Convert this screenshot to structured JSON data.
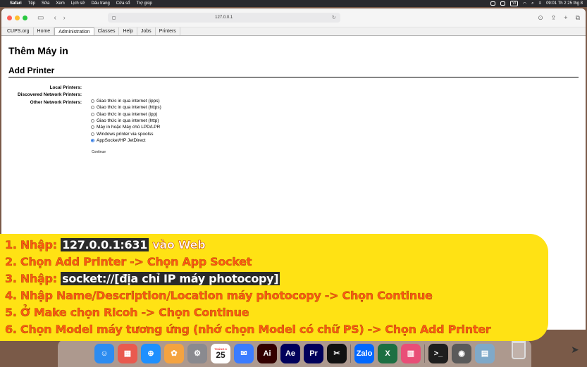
{
  "menubar": {
    "apple": "",
    "items": [
      "Safari",
      "Tệp",
      "Sửa",
      "Xem",
      "Lịch sử",
      "Dấu trang",
      "Cửa sổ",
      "Trợ giúp"
    ],
    "vi_badge": "VI",
    "clock": "09:01 Th 2 25 thg 8"
  },
  "browser": {
    "url": "127.0.0.1",
    "tabs": [
      "CUPS.org",
      "Home",
      "Administration",
      "Classes",
      "Help",
      "Jobs",
      "Printers"
    ],
    "active_tab": "Administration"
  },
  "page": {
    "title_vi": "Thêm Máy in",
    "title_en": "Add Printer",
    "local_printers_label": "Local Printers:",
    "discovered_label": "Discovered Network Printers:",
    "other_label": "Other Network Printers:",
    "options": [
      "Giao thức in qua internet (ipps)",
      "Giao thức in qua internet (https)",
      "Giao thức in qua internet (ipp)",
      "Giao thức in qua internet (http)",
      "Máy in hoặc Máy chủ LPD/LPR",
      "Windows printer via spoolss",
      "AppSocket/HP JetDirect"
    ],
    "selected_option": "AppSocket/HP JetDirect",
    "continue_label": "Continue"
  },
  "instructions": {
    "s1_prefix": "1. Nhập: ",
    "s1_highlight": "127.0.0.1:631",
    "s1_suffix": " vào Web",
    "s2": "2. Chọn Add Printer -> Chọn App Socket",
    "s3_prefix": "3. Nhập: ",
    "s3_highlight": "socket://[địa chỉ IP máy photocopy]",
    "s4": "4. Nhập Name/Description/Location máy photocopy -> Chọn Continue",
    "s5": "5. Ở Make chọn Ricoh -> Chọn Continue",
    "s6": "6. Chọn Model máy tương ứng (nhớ chọn Model có chữ PS) -> Chọn Add Printer"
  },
  "dock": {
    "calendar_month": "THÁNG 8",
    "calendar_day": "25",
    "apps": [
      {
        "name": "finder",
        "label": "☺",
        "color": "#2d8cf0"
      },
      {
        "name": "launchpad",
        "label": "▦",
        "color": "#e95a4f"
      },
      {
        "name": "safari",
        "label": "⊕",
        "color": "#1e90ff"
      },
      {
        "name": "photos",
        "label": "✿",
        "color": "#f4a340"
      },
      {
        "name": "settings",
        "label": "⚙",
        "color": "#8a8a8f"
      },
      {
        "name": "calendar",
        "label": "",
        "color": "#ffffff"
      },
      {
        "name": "messenger",
        "label": "✉",
        "color": "#3b7cff"
      },
      {
        "name": "illustrator",
        "label": "Ai",
        "color": "#330000"
      },
      {
        "name": "after-effects",
        "label": "Ae",
        "color": "#00005b"
      },
      {
        "name": "premiere",
        "label": "Pr",
        "color": "#00005b"
      },
      {
        "name": "capcut",
        "label": "✂",
        "color": "#111111"
      },
      {
        "name": "zalo",
        "label": "Zalo",
        "color": "#0068ff"
      },
      {
        "name": "excel",
        "label": "X",
        "color": "#1d6f42"
      },
      {
        "name": "files",
        "label": "▥",
        "color": "#e94e77"
      },
      {
        "name": "terminal",
        "label": ">_",
        "color": "#1e1e1e"
      },
      {
        "name": "quicktime",
        "label": "◉",
        "color": "#5a5a5a"
      },
      {
        "name": "preview",
        "label": "▤",
        "color": "#7fa9c9"
      }
    ]
  }
}
